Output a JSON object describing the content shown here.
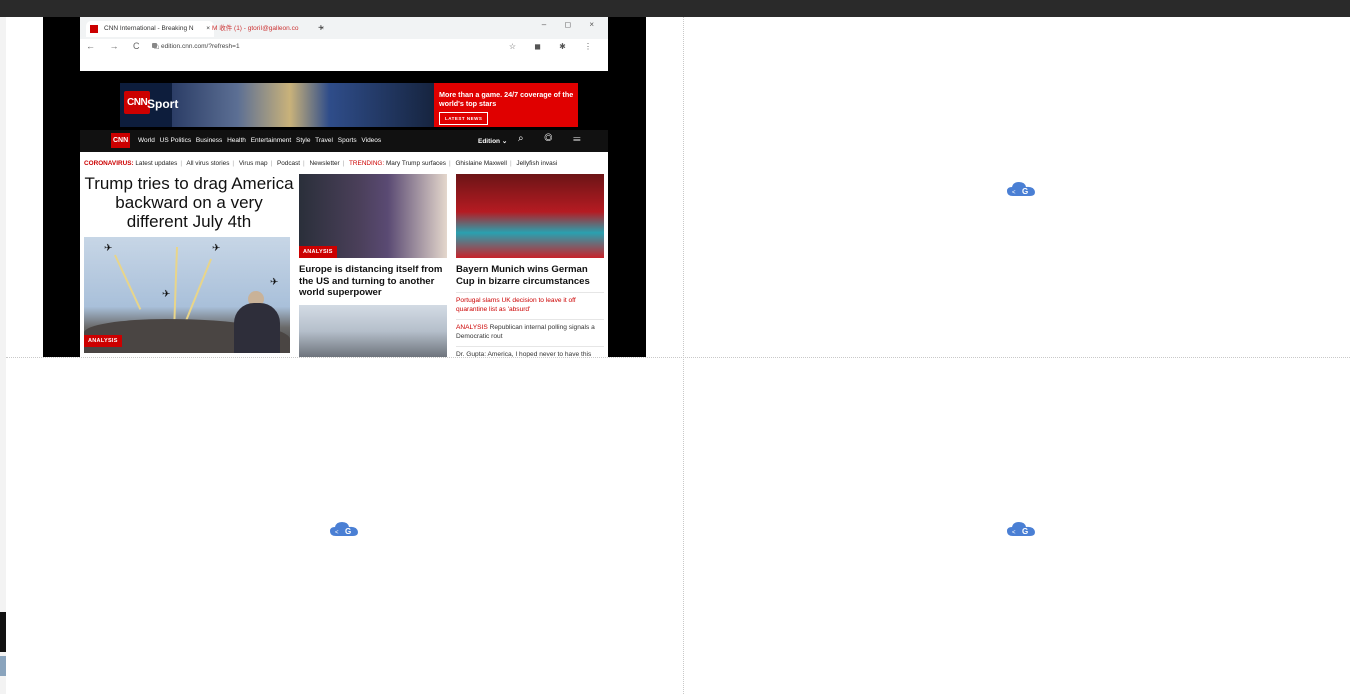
{
  "embedded_page": {
    "browser": {
      "tabs": [
        {
          "label": "CNN International - Breaking N",
          "close": "×",
          "active": true
        },
        {
          "label": "M 收件 (1) - gtoriI@galleon.co",
          "close": "×",
          "active": false
        }
      ],
      "new_tab": "+",
      "window_controls": "– ◻ ×",
      "nav_buttons": "← → C ⌂",
      "url": "edition.cnn.com/?refresh=1",
      "extension_icons": "☆ ◼ ✱ ⋮"
    },
    "sport_banner": {
      "logo": "CNN",
      "section": "Sport",
      "promo_text": "More than a game. 24/7 coverage of the world's top stars",
      "promo_button": "LATEST NEWS"
    },
    "site_nav": {
      "logo": "CNN",
      "links": [
        "World",
        "US Politics",
        "Business",
        "Health",
        "Entertainment",
        "Style",
        "Travel",
        "Sports",
        "Videos"
      ],
      "edition": "Edition ⌄",
      "tools": "⌕ ◎ ☰"
    },
    "ticker": {
      "coronavirus_label": "CORONAVIRUS:",
      "coronavirus_link": "Latest updates",
      "items": [
        "All virus stories",
        "Virus map",
        "Podcast",
        "Newsletter"
      ],
      "trending_label": "TRENDING:",
      "trending_items": [
        "Mary Trump surfaces",
        "Ghislaine Maxwell",
        "Jellyfish invasi"
      ]
    },
    "lead_story": {
      "headline": "Trump tries to drag America backward on a very different July 4th",
      "tag": "ANALYSIS"
    },
    "story_2": {
      "tag": "ANALYSIS",
      "headline": "Europe is distancing itself from the US and turning to another world superpower"
    },
    "story_3": {
      "headline": "Bayern Munich wins German Cup in bizarre circumstances",
      "links": [
        {
          "prefix": "",
          "text": "Portugal slams UK decision to leave it off quarantine list as 'absurd'",
          "red": true
        },
        {
          "prefix": "ANALYSIS",
          "text": "Republican internal polling signals a Democratic rout",
          "red": false
        },
        {
          "prefix": "",
          "text": "Dr. Gupta: America, I hoped never to have this conversation",
          "red": false
        }
      ]
    }
  },
  "placeholder_icons": [
    "cloud-g-icon",
    "cloud-g-icon",
    "cloud-g-icon"
  ],
  "colors": {
    "cnn_red": "#cc0000",
    "placeholder_icon": "#4a7fd4",
    "top_strip": "#2a2a2a"
  }
}
